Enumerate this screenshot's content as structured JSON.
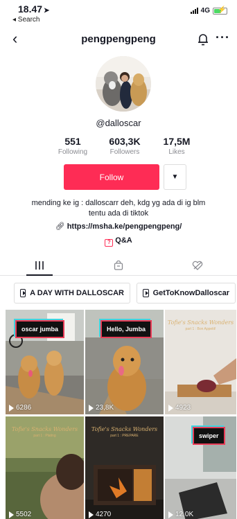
{
  "status_bar": {
    "time": "18.47",
    "back_label": "◂ Search",
    "network": "4G"
  },
  "nav": {
    "title": "pengpengpeng"
  },
  "profile": {
    "handle": "@dalloscar",
    "stats": [
      {
        "value": "551",
        "label": "Following"
      },
      {
        "value": "603,3K",
        "label": "Followers"
      },
      {
        "value": "17,5M",
        "label": "Likes"
      }
    ],
    "follow_label": "Follow",
    "bio_line1": "mending ke ig : dalloscarr deh, kdg yg ada di ig blm",
    "bio_line2": "tentu ada di tiktok",
    "link": "https://msha.ke/pengpengpeng/",
    "qa_label": "Q&A"
  },
  "playlists": [
    {
      "label": "A DAY WITH DALLOSCAR"
    },
    {
      "label": "GetToKnowDalloscar"
    }
  ],
  "videos": [
    {
      "caption": "oscar jumba",
      "views": "6286"
    },
    {
      "caption": "Hello, Jumba",
      "views": "23,8K"
    },
    {
      "caption": "",
      "views": "4923",
      "watermark": "Tofie's Snacks Wonders",
      "watermark_sub": "part 1 : Bon Appetit!"
    },
    {
      "caption": "",
      "views": "5502",
      "watermark": "Tofie's Snacks Wonders",
      "watermark_sub": "part 1 : Plating"
    },
    {
      "caption": "",
      "views": "4270",
      "watermark": "Tofie's Snacks Wonders",
      "watermark_sub": "part 1 : PREPARE"
    },
    {
      "caption": "swiper",
      "views": "12,0K"
    }
  ],
  "colors": {
    "accent": "#fe2c55",
    "caption_border": "#e93c57",
    "caption_shadow": "#3fd5e0"
  }
}
